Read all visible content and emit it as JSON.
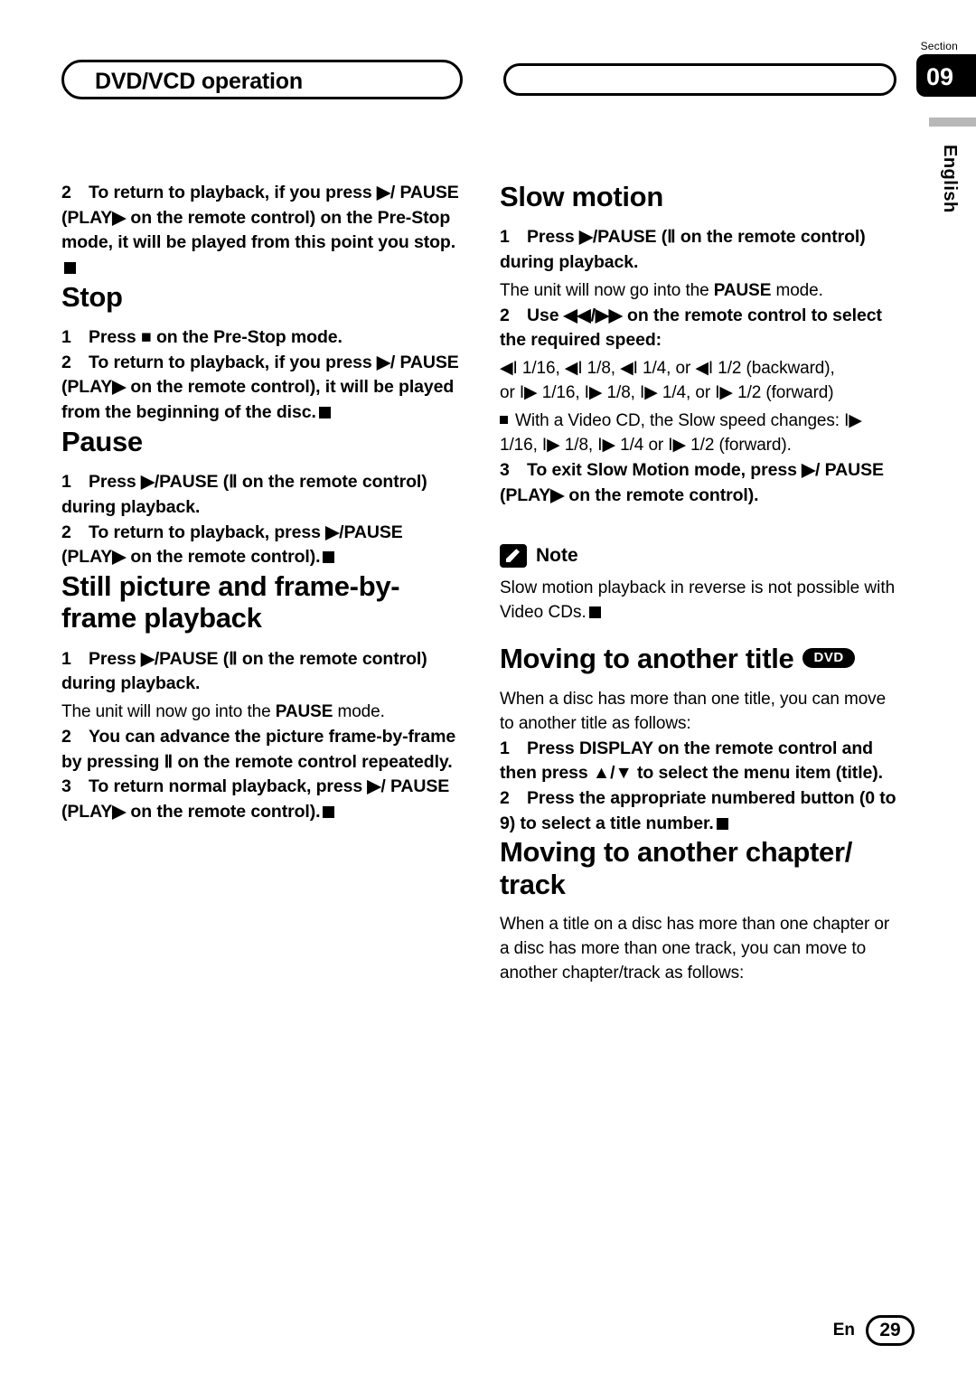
{
  "header": {
    "left_title": "DVD/VCD operation",
    "section_label": "Section",
    "section_number": "09",
    "language": "English"
  },
  "left_column": {
    "step_continued": {
      "num": "2",
      "text": "To return to playback, if you press ▶/ PAUSE (PLAY▶ on the remote control) on the Pre-Stop mode, it will be played from this point you stop."
    },
    "stop": {
      "heading": "Stop",
      "step1": {
        "num": "1",
        "text": "Press ■ on the Pre-Stop mode."
      },
      "step2": {
        "num": "2",
        "text": "To return to playback, if you press ▶/ PAUSE (PLAY▶ on the remote control), it will be played from the beginning of the disc."
      }
    },
    "pause": {
      "heading": "Pause",
      "step1": {
        "num": "1",
        "text": "Press ▶/PAUSE (Ⅱ on the remote control) during playback."
      },
      "step2": {
        "num": "2",
        "text": "To return to playback, press ▶/PAUSE (PLAY▶ on the remote control)."
      }
    },
    "still_picture": {
      "heading": "Still picture and frame-by-frame playback",
      "step1": {
        "num": "1",
        "text": "Press ▶/PAUSE (Ⅱ on the remote control) during playback."
      },
      "step1_note": "The unit will now go into the PAUSE mode.",
      "step1_note_bold": "PAUSE",
      "step2": {
        "num": "2",
        "text": "You can advance the picture frame-by-frame by pressing Ⅱ on the remote control repeatedly."
      },
      "step3": {
        "num": "3",
        "text": "To return normal playback, press ▶/ PAUSE (PLAY▶ on the remote control)."
      }
    }
  },
  "right_column": {
    "slow_motion": {
      "heading": "Slow motion",
      "step1": {
        "num": "1",
        "text": "Press ▶/PAUSE (Ⅱ on the remote control) during playback."
      },
      "step1_note": "The unit will now go into the PAUSE mode.",
      "step2": {
        "num": "2",
        "text": "Use ◀◀/▶▶ on the remote control to select the required speed:"
      },
      "speeds_line1": "◀I 1/16, ◀I 1/8, ◀I 1/4, or ◀I 1/2 (backward),",
      "speeds_line2": "or I▶ 1/16, I▶ 1/8, I▶ 1/4, or I▶ 1/2 (forward)",
      "vcd_bullet": "With a Video CD, the Slow speed changes: I▶ 1/16, I▶ 1/8, I▶ 1/4 or I▶ 1/2 (forward).",
      "step3": {
        "num": "3",
        "text": "To exit Slow Motion mode, press ▶/ PAUSE (PLAY▶ on the remote control)."
      },
      "note_label": "Note",
      "note_text": "Slow motion playback in reverse is not possible with Video CDs."
    },
    "moving_title": {
      "heading": "Moving to another title",
      "badge": "DVD",
      "intro": "When a disc has more than one title, you can move to another title as follows:",
      "step1": {
        "num": "1",
        "text": "Press DISPLAY on the remote control and then press ▲/▼ to select the menu item (title)."
      },
      "step2": {
        "num": "2",
        "text": "Press the appropriate numbered button (0 to 9) to select a title number."
      }
    },
    "moving_chapter": {
      "heading": "Moving to another chapter/ track",
      "intro": "When a title on a disc has more than one chapter or a disc has more than one track, you can move to another chapter/track as follows:"
    }
  },
  "footer": {
    "lang_code": "En",
    "page_number": "29"
  }
}
